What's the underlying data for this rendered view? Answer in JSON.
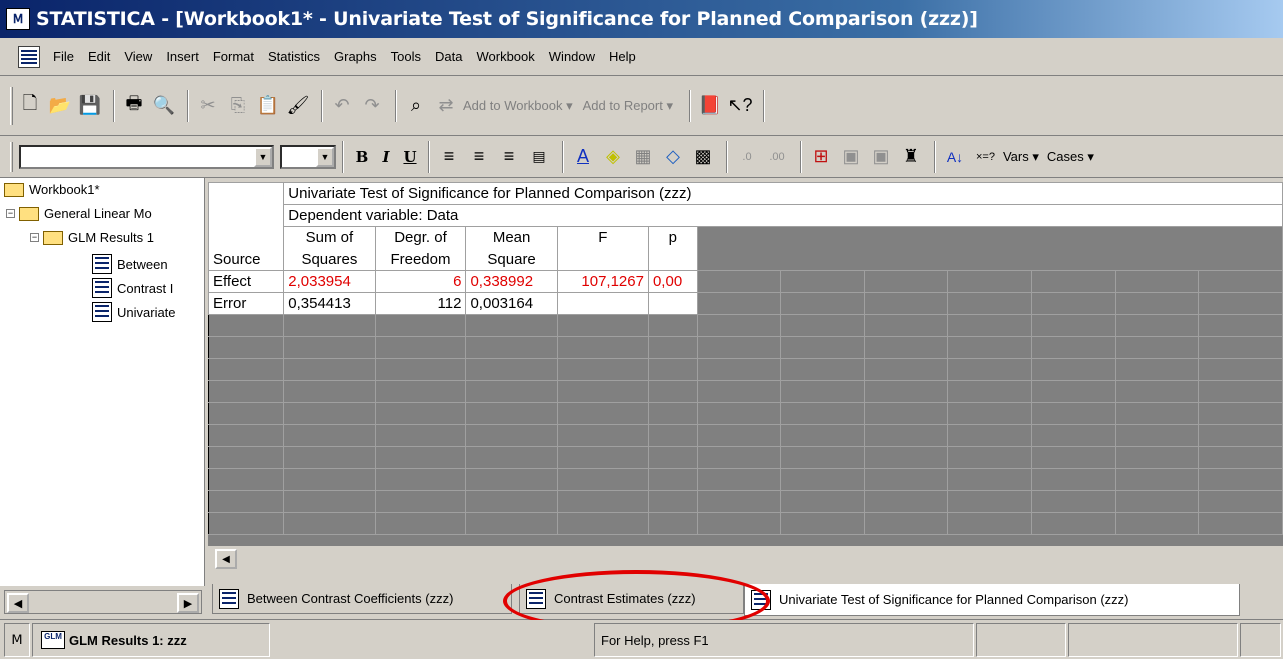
{
  "window": {
    "title": "STATISTICA - [Workbook1* - Univariate Test of Significance for Planned Comparison (zzz)]"
  },
  "menu": [
    "File",
    "Edit",
    "View",
    "Insert",
    "Format",
    "Statistics",
    "Graphs",
    "Tools",
    "Data",
    "Workbook",
    "Window",
    "Help"
  ],
  "toolbar1": {
    "add_to_workbook": "Add to Workbook ▾",
    "add_to_report": "Add to Report ▾"
  },
  "toolbar2": {
    "bold": "B",
    "italic": "I",
    "underline": "U",
    "vars": "Vars ▾",
    "cases": "Cases ▾"
  },
  "tree": {
    "root": "Workbook1*",
    "glm": "General Linear Mo",
    "results": "GLM Results 1",
    "leaves": [
      "Between",
      "Contrast I",
      "Univariate"
    ]
  },
  "spreadsheet": {
    "title_line1": "Univariate Test of Significance for Planned Comparison (zzz)",
    "title_line2": "Dependent variable: Data",
    "row_header_label": "Source",
    "columns": [
      {
        "line1": "Sum of",
        "line2": "Squares"
      },
      {
        "line1": "Degr. of",
        "line2": "Freedom"
      },
      {
        "line1": "Mean",
        "line2": "Square"
      },
      {
        "line1": "F",
        "line2": ""
      },
      {
        "line1": "p",
        "line2": ""
      }
    ],
    "rows": [
      {
        "source": "Effect",
        "ss": "2,033954",
        "df": "6",
        "ms": "0,338992",
        "f": "107,1267",
        "p": "0,00"
      },
      {
        "source": "Error",
        "ss": "0,354413",
        "df": "112",
        "ms": "0,003164",
        "f": "",
        "p": ""
      }
    ]
  },
  "tabs": [
    "Between Contrast Coefficients (zzz)",
    "Contrast Estimates (zzz)",
    "Univariate Test of Significance for Planned Comparison (zzz)"
  ],
  "status": {
    "left": "GLM Results 1: zzz",
    "help": "For Help, press F1"
  }
}
